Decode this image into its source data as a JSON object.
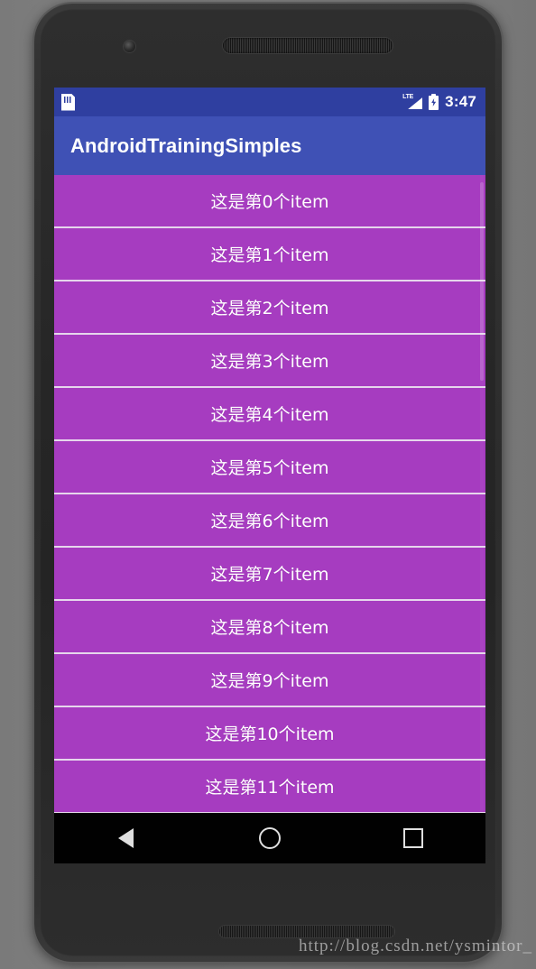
{
  "device": {
    "camera_icon": "front-camera",
    "earpiece_icon": "earpiece-speaker",
    "bottom_speaker_icon": "bottom-speaker"
  },
  "status_bar": {
    "sd_icon": "sd-card-icon",
    "signal_icon": "lte-signal-icon",
    "signal_label": "LTE",
    "battery_icon": "battery-charging-icon",
    "time": "3:47",
    "background_color": "#2f3fa0"
  },
  "app_bar": {
    "title": "AndroidTrainingSimples",
    "background_color": "#3f51b5",
    "text_color": "#ffffff"
  },
  "list": {
    "background_color": "#a63cc0",
    "divider_color": "#e6d6ec",
    "text_color": "#ffffff",
    "items": [
      {
        "label": "这是第0个item"
      },
      {
        "label": "这是第1个item"
      },
      {
        "label": "这是第2个item"
      },
      {
        "label": "这是第3个item"
      },
      {
        "label": "这是第4个item"
      },
      {
        "label": "这是第5个item"
      },
      {
        "label": "这是第6个item"
      },
      {
        "label": "这是第7个item"
      },
      {
        "label": "这是第8个item"
      },
      {
        "label": "这是第9个item"
      },
      {
        "label": "这是第10个item"
      },
      {
        "label": "这是第11个item"
      }
    ]
  },
  "nav_bar": {
    "background_color": "#010101",
    "back_icon": "back-triangle-icon",
    "home_icon": "home-circle-icon",
    "recents_icon": "recents-square-icon"
  },
  "watermark": {
    "text": "http://blog.csdn.net/ysmintor_"
  }
}
